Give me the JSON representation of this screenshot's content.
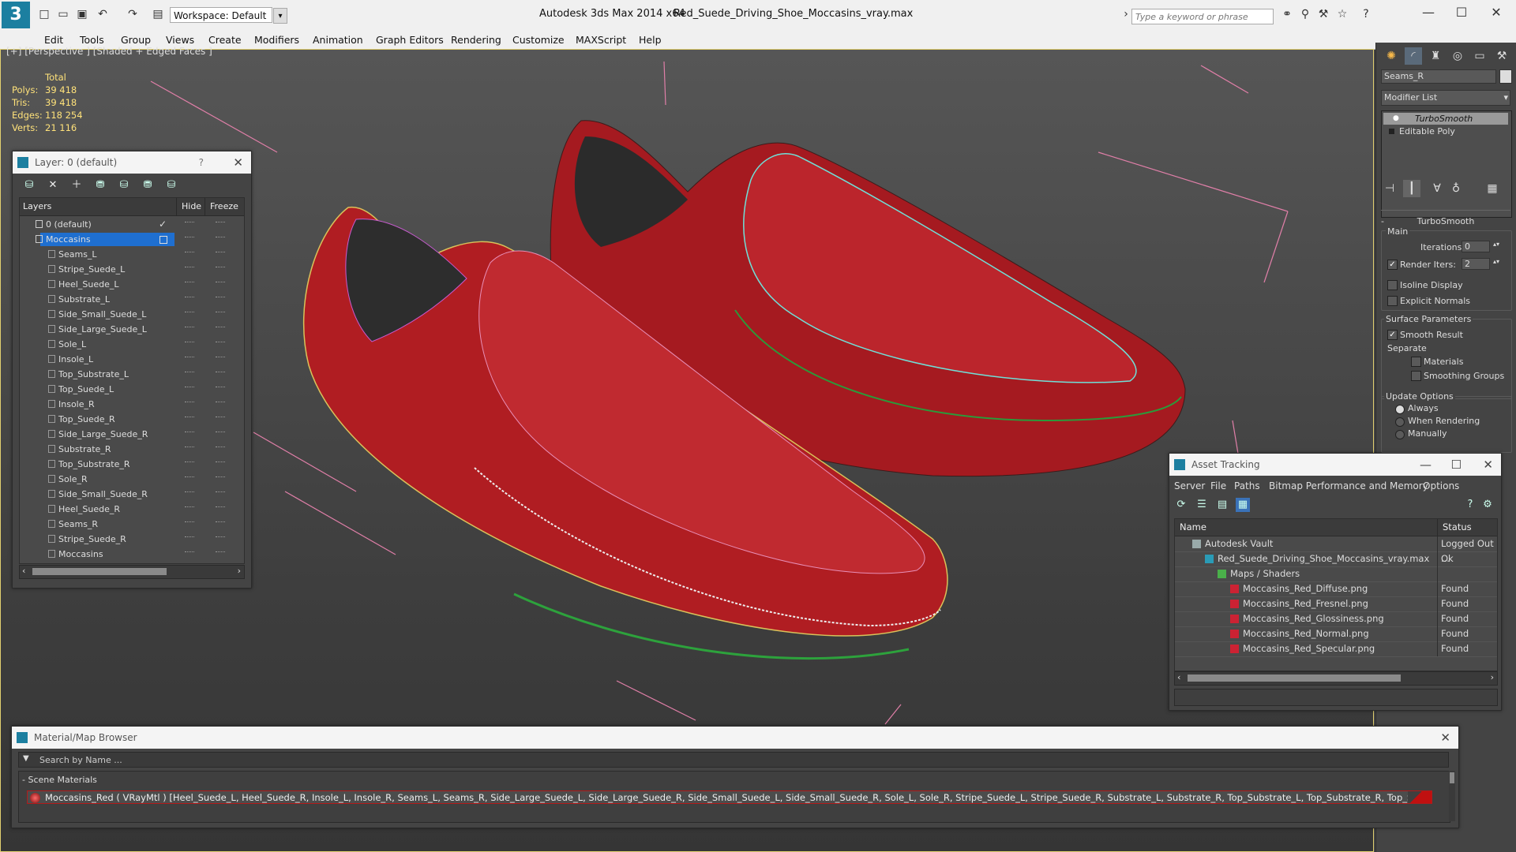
{
  "titlebar": {
    "app": "Autodesk 3ds Max  2014 x64",
    "file": "Red_Suede_Driving_Shoe_Moccasins_vray.max",
    "workspace": "Workspace: Default",
    "search_placeholder": "Type a keyword or phrase"
  },
  "menu": [
    "Edit",
    "Tools",
    "Group",
    "Views",
    "Create",
    "Modifiers",
    "Animation",
    "Graph Editors",
    "Rendering",
    "Customize",
    "MAXScript",
    "Help"
  ],
  "viewport": {
    "label": "[+] [Perspective ] [Shaded + Edged Faces ]",
    "stats": {
      "header": "Total",
      "polys_label": "Polys:",
      "polys": "39 418",
      "tris_label": "Tris:",
      "tris": "39 418",
      "edges_label": "Edges:",
      "edges": "118 254",
      "verts_label": "Verts:",
      "verts": "21 116"
    }
  },
  "layer_panel": {
    "title": "Layer: 0 (default)",
    "help": "?",
    "col_layers": "Layers",
    "col_hide": "Hide",
    "col_freeze": "Freeze",
    "rows": [
      {
        "name": "0 (default)",
        "kind": "layer"
      },
      {
        "name": "Moccasins",
        "kind": "layer-selected"
      },
      {
        "name": "Seams_L",
        "kind": "object"
      },
      {
        "name": "Stripe_Suede_L",
        "kind": "object"
      },
      {
        "name": "Heel_Suede_L",
        "kind": "object"
      },
      {
        "name": "Substrate_L",
        "kind": "object"
      },
      {
        "name": "Side_Small_Suede_L",
        "kind": "object"
      },
      {
        "name": "Side_Large_Suede_L",
        "kind": "object"
      },
      {
        "name": "Sole_L",
        "kind": "object"
      },
      {
        "name": "Insole_L",
        "kind": "object"
      },
      {
        "name": "Top_Substrate_L",
        "kind": "object"
      },
      {
        "name": "Top_Suede_L",
        "kind": "object"
      },
      {
        "name": "Insole_R",
        "kind": "object"
      },
      {
        "name": "Top_Suede_R",
        "kind": "object"
      },
      {
        "name": "Side_Large_Suede_R",
        "kind": "object"
      },
      {
        "name": "Substrate_R",
        "kind": "object"
      },
      {
        "name": "Top_Substrate_R",
        "kind": "object"
      },
      {
        "name": "Sole_R",
        "kind": "object"
      },
      {
        "name": "Side_Small_Suede_R",
        "kind": "object"
      },
      {
        "name": "Heel_Suede_R",
        "kind": "object"
      },
      {
        "name": "Seams_R",
        "kind": "object"
      },
      {
        "name": "Stripe_Suede_R",
        "kind": "object"
      },
      {
        "name": "Moccasins",
        "kind": "object"
      }
    ]
  },
  "command_panel": {
    "object_name": "Seams_R",
    "modifier_list": "Modifier List",
    "stack": [
      "TurboSmooth",
      "Editable Poly"
    ],
    "rollout_title": "TurboSmooth",
    "main_label": "Main",
    "iterations_label": "Iterations:",
    "iterations": "0",
    "render_iters_label": "Render Iters:",
    "render_iters": "2",
    "isoline": "Isoline Display",
    "explicit": "Explicit Normals",
    "surface_params": "Surface Parameters",
    "smooth_result": "Smooth Result",
    "separate": "Separate",
    "materials": "Materials",
    "smoothing_groups": "Smoothing Groups",
    "update_options": "Update Options",
    "always": "Always",
    "when_rendering": "When Rendering",
    "manually": "Manually"
  },
  "asset_panel": {
    "title": "Asset Tracking",
    "menu": [
      "Server",
      "File",
      "Paths",
      "Bitmap Performance and Memory",
      "Options"
    ],
    "col_name": "Name",
    "col_status": "Status",
    "rows": [
      {
        "name": "Autodesk Vault",
        "status": "Logged Out ...",
        "indent": 1,
        "icon": "vault"
      },
      {
        "name": "Red_Suede_Driving_Shoe_Moccasins_vray.max",
        "status": "Ok",
        "indent": 2,
        "icon": "max"
      },
      {
        "name": "Maps / Shaders",
        "status": "",
        "indent": 3,
        "icon": "maps"
      },
      {
        "name": "Moccasins_Red_Diffuse.png",
        "status": "Found",
        "indent": 4,
        "icon": "png"
      },
      {
        "name": "Moccasins_Red_Fresnel.png",
        "status": "Found",
        "indent": 4,
        "icon": "png"
      },
      {
        "name": "Moccasins_Red_Glossiness.png",
        "status": "Found",
        "indent": 4,
        "icon": "png"
      },
      {
        "name": "Moccasins_Red_Normal.png",
        "status": "Found",
        "indent": 4,
        "icon": "png"
      },
      {
        "name": "Moccasins_Red_Specular.png",
        "status": "Found",
        "indent": 4,
        "icon": "png"
      }
    ]
  },
  "material_browser": {
    "title": "Material/Map Browser",
    "search": "Search by Name ...",
    "group": "- Scene Materials",
    "item": "Moccasins_Red  ( VRayMtl ) [Heel_Suede_L, Heel_Suede_R, Insole_L, Insole_R, Seams_L, Seams_R, Side_Large_Suede_L, Side_Large_Suede_R, Side_Small_Suede_L, Side_Small_Suede_R, Sole_L, Sole_R, Stripe_Suede_L, Stripe_Suede_R, Substrate_L, Substrate_R, Top_Substrate_L, Top_Substrate_R, Top_Suede_L, Top_Suede_R]"
  },
  "colors": {
    "accent": "#1c7fa0",
    "selection": "#1f6fd0",
    "shoe": "#b51d22",
    "viewport_border": "#e2d070"
  }
}
